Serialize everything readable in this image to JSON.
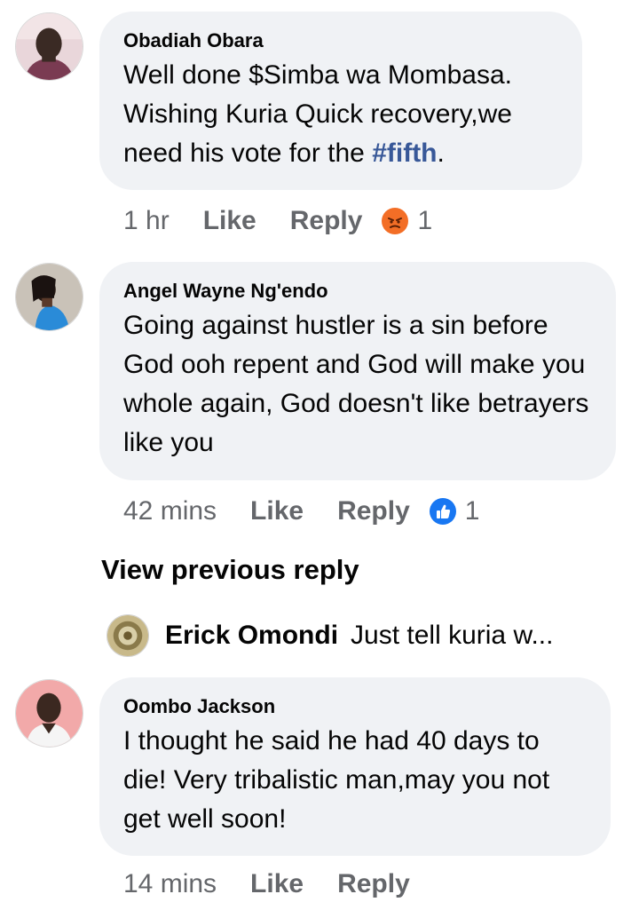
{
  "comments": [
    {
      "author": "Obadiah Obara",
      "text_parts": [
        "Well done $Simba wa Mombasa. Wishing Kuria Quick recovery,we need his vote for the ",
        "#fifth",
        "."
      ],
      "time": "1 hr",
      "like_label": "Like",
      "reply_label": "Reply",
      "reaction_icon": "angry-reaction-icon",
      "reaction_count": "1"
    },
    {
      "author": "Angel Wayne Ng'endo",
      "text": "Going against hustler is a sin before God ooh repent and God will make you whole again, God doesn't like betrayers like you",
      "time": "42 mins",
      "like_label": "Like",
      "reply_label": "Reply",
      "reaction_icon": "like-reaction-icon",
      "reaction_count": "1"
    },
    {
      "author": "Oombo Jackson",
      "text": "I thought he said he had 40 days to die! Very tribalistic man,may you not get well soon!",
      "time": "14 mins",
      "like_label": "Like",
      "reply_label": "Reply"
    }
  ],
  "view_previous": "View previous reply",
  "reply_preview": {
    "name": "Erick Omondi",
    "snippet": "Just tell kuria w..."
  },
  "colors": {
    "bubble": "#f0f2f5",
    "meta_text": "#65676b",
    "hashtag": "#385898",
    "angry": "#f36e26",
    "like": "#1877f2"
  }
}
